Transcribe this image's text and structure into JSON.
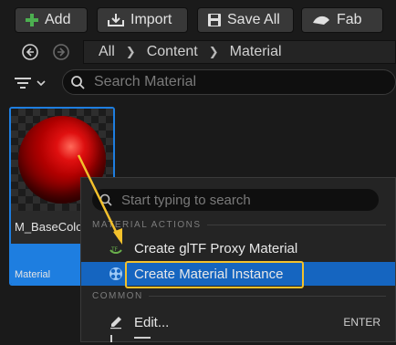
{
  "toolbar": {
    "add_label": "Add",
    "import_label": "Import",
    "save_all_label": "Save All",
    "fab_label": "Fab"
  },
  "breadcrumb": [
    "All",
    "Content",
    "Material"
  ],
  "search": {
    "placeholder": "Search Material"
  },
  "asset": {
    "name": "M_BaseColor",
    "type": "Material"
  },
  "context_menu": {
    "search_placeholder": "Start typing to search",
    "section_material_actions": "MATERIAL ACTIONS",
    "item_gltf_proxy": "Create glTF Proxy Material",
    "item_material_instance": "Create Material Instance",
    "section_common": "COMMON",
    "item_edit": "Edit...",
    "item_edit_shortcut": "ENTER"
  },
  "colors": {
    "accent": "#1e7ee0",
    "highlight": "#1565c0",
    "annotation": "#f3c12c",
    "add_green": "#4caf50"
  }
}
